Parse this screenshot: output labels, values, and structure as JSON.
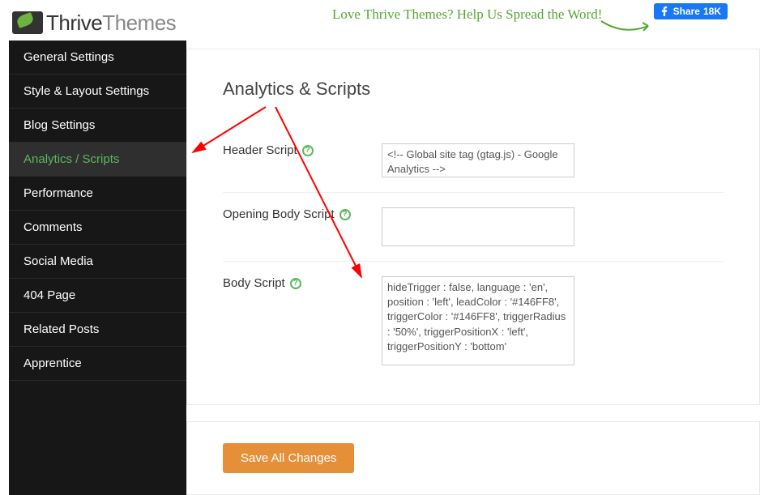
{
  "brand": {
    "name_a": "Thrive",
    "name_b": "Themes"
  },
  "cta": {
    "text": "Love Thrive Themes? Help Us Spread the Word!"
  },
  "fb": {
    "label": "Share",
    "count": "18K"
  },
  "sidebar": {
    "items": [
      {
        "label": "General Settings"
      },
      {
        "label": "Style & Layout Settings"
      },
      {
        "label": "Blog Settings"
      },
      {
        "label": "Analytics / Scripts"
      },
      {
        "label": "Performance"
      },
      {
        "label": "Comments"
      },
      {
        "label": "Social Media"
      },
      {
        "label": "404 Page"
      },
      {
        "label": "Related Posts"
      },
      {
        "label": "Apprentice"
      }
    ],
    "active_index": 3
  },
  "page": {
    "title": "Analytics & Scripts",
    "fields": {
      "header": {
        "label": "Header Script",
        "value": "<!-- Global site tag (gtag.js) - Google Analytics -->"
      },
      "opening_body": {
        "label": "Opening Body Script",
        "value": ""
      },
      "body": {
        "label": "Body Script",
        "value": "hideTrigger : false, language : 'en', position : 'left', leadColor : '#146FF8', triggerColor : '#146FF8', triggerRadius : '50%', triggerPositionX : 'left', triggerPositionY : 'bottom'"
      }
    },
    "save_label": "Save All Changes"
  },
  "colors": {
    "accent": "#5cb85c",
    "save": "#e59039",
    "fb": "#1877f2"
  }
}
